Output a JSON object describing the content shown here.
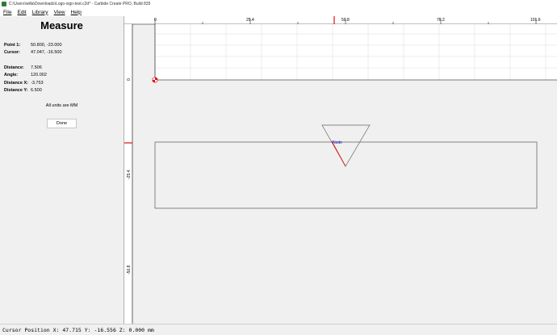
{
  "window": {
    "title": "C:\\Users\\willa\\Downloads\\Logo-sign-test.c2d* - Carbide Create PRO, Build 835"
  },
  "menu": [
    "File",
    "Edit",
    "Library",
    "View",
    "Help"
  ],
  "panel": {
    "title": "Measure",
    "point1_label": "Point 1:",
    "point1_value": "50.800, -23.000",
    "cursor_label": "Cursor:",
    "cursor_value": "47.047, -16.500",
    "distance_label": "Distance:",
    "distance_value": "7.506",
    "angle_label": "Angle:",
    "angle_value": "120.002",
    "dx_label": "Distance X:",
    "dx_value": "-3.753",
    "dy_label": "Distance Y:",
    "dy_value": "6.500",
    "units_note": "All units are MM",
    "done_label": "Done"
  },
  "canvas": {
    "top_ruler_labels": [
      "0",
      "25.4",
      "50.8",
      "76.2",
      "101.6"
    ],
    "side_ruler_labels": [
      "0",
      "-25.4",
      "-50.8"
    ],
    "node_label": "Node"
  },
  "colors": {
    "accent": "#e01010",
    "node": "#1010c0",
    "window_bg": "#f0f0f0"
  },
  "status": {
    "text": "Cursor Position X: 47.715 Y: -16.556 Z: 0.000 mm"
  }
}
